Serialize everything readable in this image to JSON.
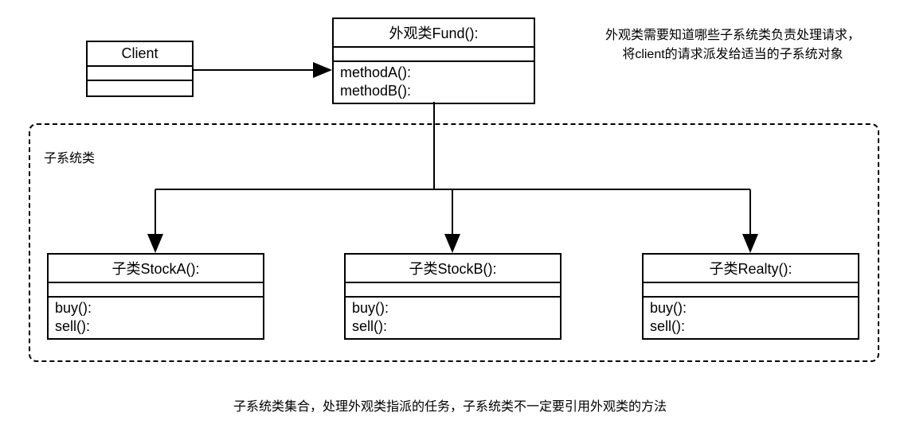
{
  "client": {
    "title": "Client"
  },
  "facade": {
    "title": "外观类Fund():",
    "method1": "methodA():",
    "method2": "methodB():"
  },
  "annotation": {
    "line1": "外观类需要知道哪些子系统类负责处理请求，",
    "line2": "将client的请求派发给适当的子系统对象"
  },
  "subsystem": {
    "label": "子系统类"
  },
  "stockA": {
    "title": "子类StockA():",
    "method1": "buy():",
    "method2": "sell():"
  },
  "stockB": {
    "title": "子类StockB():",
    "method1": "buy():",
    "method2": "sell():"
  },
  "realty": {
    "title": "子类Realty():",
    "method1": "buy():",
    "method2": "sell():"
  },
  "caption": {
    "text": "子系统类集合，处理外观类指派的任务，子系统类不一定要引用外观类的方法"
  }
}
